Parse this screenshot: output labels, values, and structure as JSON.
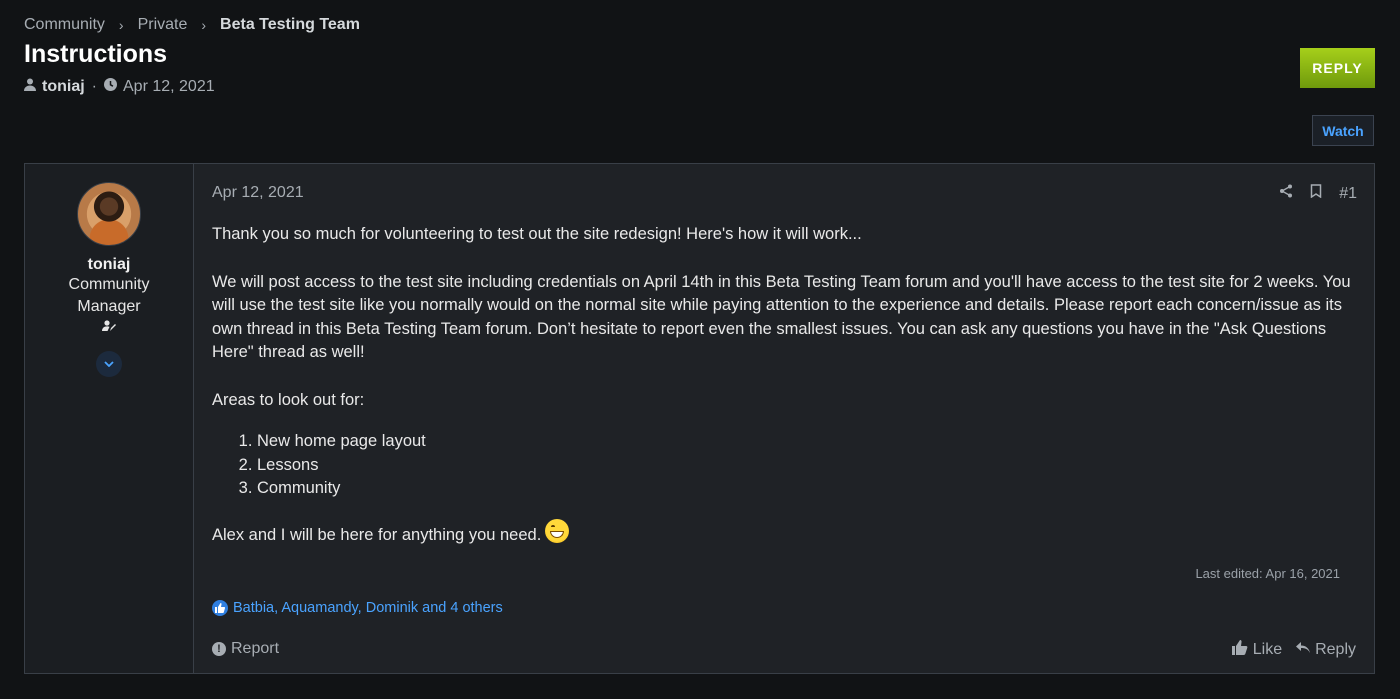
{
  "breadcrumb": {
    "items": [
      "Community",
      "Private"
    ],
    "current": "Beta Testing Team"
  },
  "page": {
    "title": "Instructions",
    "author": "toniaj",
    "date": "Apr 12, 2021"
  },
  "buttons": {
    "reply": "REPLY",
    "watch": "Watch"
  },
  "post": {
    "user": {
      "name": "toniaj",
      "title": "Community Manager"
    },
    "date": "Apr 12, 2021",
    "number": "#1",
    "body": {
      "intro": "Thank you so much for volunteering to test out the site redesign! Here's how it will work...",
      "details": "We will post access to the test site including credentials on April 14th in this Beta Testing Team forum and you'll have access to the test site for 2 weeks. You will use the test site like you normally would on the normal site while paying attention to the experience and details. Please report each concern/issue as its own thread in this Beta Testing Team forum. Don’t hesitate to report even the smallest issues. You can ask any questions you have in the \"Ask Questions Here\" thread as well!",
      "areas_heading": "Areas to look out for:",
      "areas": [
        "New home page layout",
        "Lessons",
        "Community"
      ],
      "closing": "Alex and I will be here for anything you need."
    },
    "last_edited": "Last edited: Apr 16, 2021",
    "reactions": "Batbia, Aquamandy, Dominik and 4 others",
    "report_label": "Report",
    "like_label": "Like",
    "reply_label": "Reply"
  },
  "icons": {
    "user": "user-icon",
    "clock": "clock-icon",
    "share": "share-icon",
    "bookmark": "bookmark-icon",
    "chevron": "chevron-down-icon",
    "like": "thumbs-up-icon",
    "reply": "reply-arrow-icon",
    "report": "alert-icon"
  },
  "colors": {
    "accent": "#4aa3ff",
    "reply_button": "#8fbf14",
    "background": "#111315"
  }
}
